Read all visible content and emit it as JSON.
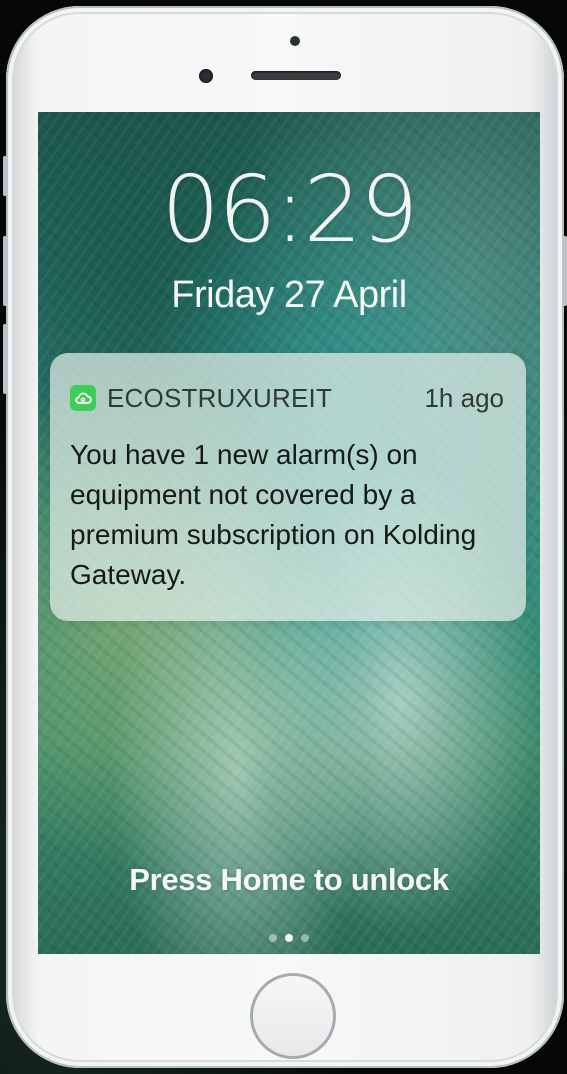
{
  "lock_screen": {
    "time": "06:29",
    "date": "Friday 27 April",
    "unlock_hint": "Press Home to unlock"
  },
  "notification": {
    "app_icon": "cloud-icon",
    "app_name": "ECOSTRUXUREIT",
    "time_ago": "1h ago",
    "message": "You have 1 new alarm(s) on equipment not covered by a premium subscription on Kolding Gateway."
  },
  "colors": {
    "app_icon_bg": "#3dcd58"
  },
  "page_indicator": {
    "pages": 3,
    "active_page": 2
  }
}
